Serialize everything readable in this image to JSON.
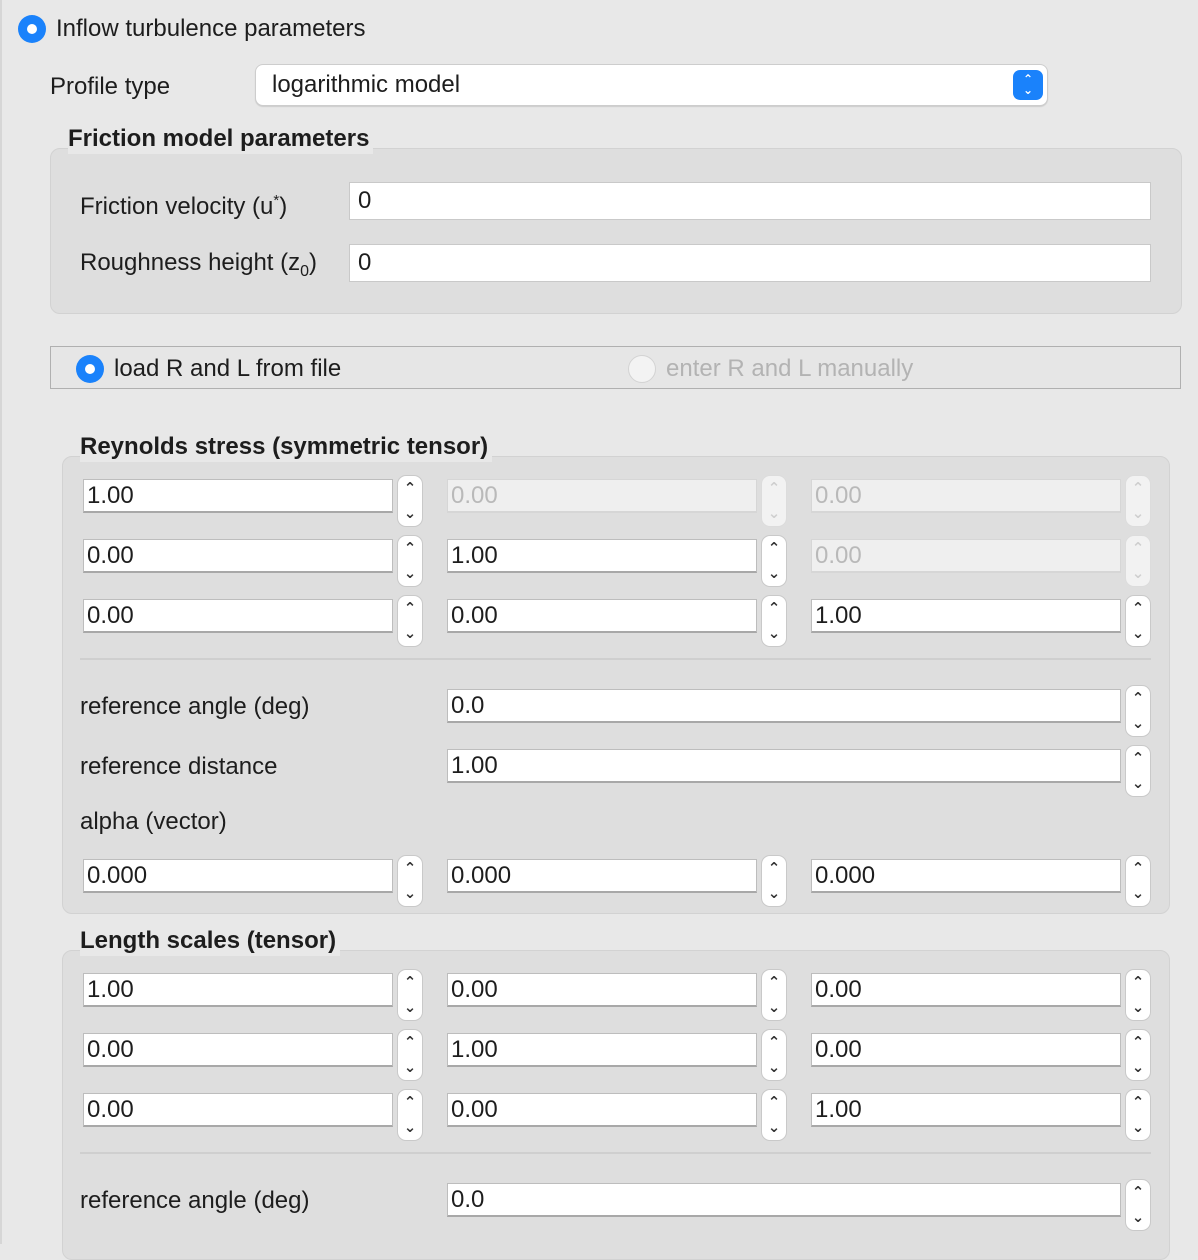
{
  "inflow": {
    "title": "Inflow turbulence parameters"
  },
  "profile": {
    "label": "Profile type",
    "value": "logarithmic model"
  },
  "friction": {
    "title": "Friction model parameters",
    "velocity_label": "Friction velocity (u",
    "velocity_sup": "*",
    "velocity_close": ")",
    "velocity_value": "0",
    "roughness_label": "Roughness height (z",
    "roughness_sub": "0",
    "roughness_close": ")",
    "roughness_value": "0"
  },
  "source": {
    "option_file": "load R and L from file",
    "option_manual": "enter R and L manually"
  },
  "reynolds": {
    "title": "Reynolds stress (symmetric tensor)",
    "rows": [
      [
        "1.00",
        "0.00",
        "0.00"
      ],
      [
        "0.00",
        "1.00",
        "0.00"
      ],
      [
        "0.00",
        "0.00",
        "1.00"
      ]
    ],
    "ref_angle_label": "reference angle (deg)",
    "ref_angle_value": "0.0",
    "ref_distance_label": "reference distance",
    "ref_distance_value": "1.00",
    "alpha_label": "alpha (vector)",
    "alpha": [
      "0.000",
      "0.000",
      "0.000"
    ]
  },
  "length": {
    "title": "Length scales (tensor)",
    "rows": [
      [
        "1.00",
        "0.00",
        "0.00"
      ],
      [
        "0.00",
        "1.00",
        "0.00"
      ],
      [
        "0.00",
        "0.00",
        "1.00"
      ]
    ],
    "ref_angle_label": "reference angle (deg)",
    "ref_angle_value": "0.0"
  },
  "colors": {
    "accent": "#1a82fb",
    "background": "#e8e8e8",
    "panel": "#dedede"
  }
}
